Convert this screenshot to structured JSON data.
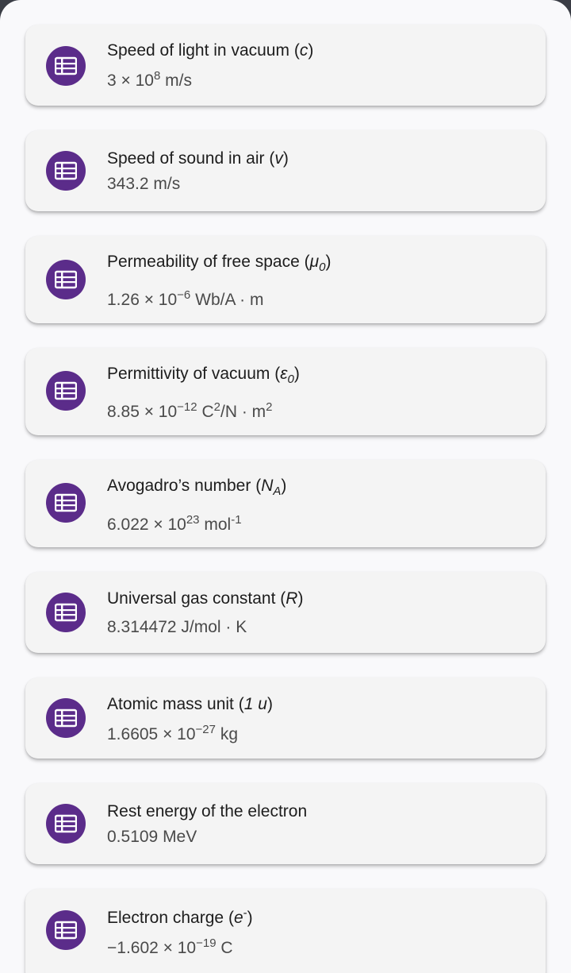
{
  "colors": {
    "icon_bg": "#5b2c8a",
    "card_bg": "#f4f4f4",
    "sheet_bg": "#f9f9fb"
  },
  "constants": [
    {
      "icon": "table-list-icon",
      "title": "Speed of light in vacuum",
      "symbol": "c",
      "value_mantissa": "3 × 10",
      "value_exponent": "8",
      "value_unit": "m/s"
    },
    {
      "icon": "table-list-icon",
      "title": "Speed of sound in air",
      "symbol": "v",
      "value": "343.2 m/s"
    },
    {
      "icon": "table-list-icon",
      "title": "Permeability of free space",
      "symbol": "μ",
      "symbol_sub": "0",
      "value_mantissa": "1.26 × 10",
      "value_exponent": "−6",
      "value_unit": "Wb/A · m"
    },
    {
      "icon": "table-list-icon",
      "title": "Permittivity of vacuum",
      "symbol": "ε",
      "symbol_sub": "0",
      "value_mantissa": "8.85 × 10",
      "value_exponent": "−12",
      "value_unit_a": "C",
      "value_unit_a_exp": "2",
      "value_unit_b": "/N · m",
      "value_unit_b_exp": "2"
    },
    {
      "icon": "table-list-icon",
      "title": "Avogadro’s number",
      "symbol": "N",
      "symbol_sub": "A",
      "value_mantissa": "6.022 × 10",
      "value_exponent": "23",
      "value_unit": "mol",
      "value_unit_exp": "-1"
    },
    {
      "icon": "table-list-icon",
      "title": "Universal gas constant",
      "symbol": "R",
      "value": "8.314472 J/mol · K"
    },
    {
      "icon": "table-list-icon",
      "title": "Atomic mass unit",
      "symbol": "1 u",
      "value_mantissa": "1.6605 × 10",
      "value_exponent": "−27",
      "value_unit": "kg"
    },
    {
      "icon": "table-list-icon",
      "title": "Rest energy of the electron",
      "value": "0.5109 MeV"
    },
    {
      "icon": "table-list-icon",
      "title": "Electron charge",
      "symbol": "e",
      "symbol_sup": "-",
      "value_mantissa": "−1.602 × 10",
      "value_exponent": "−19",
      "value_unit": "C"
    }
  ],
  "punct": {
    "open": "(",
    "close": ")"
  }
}
